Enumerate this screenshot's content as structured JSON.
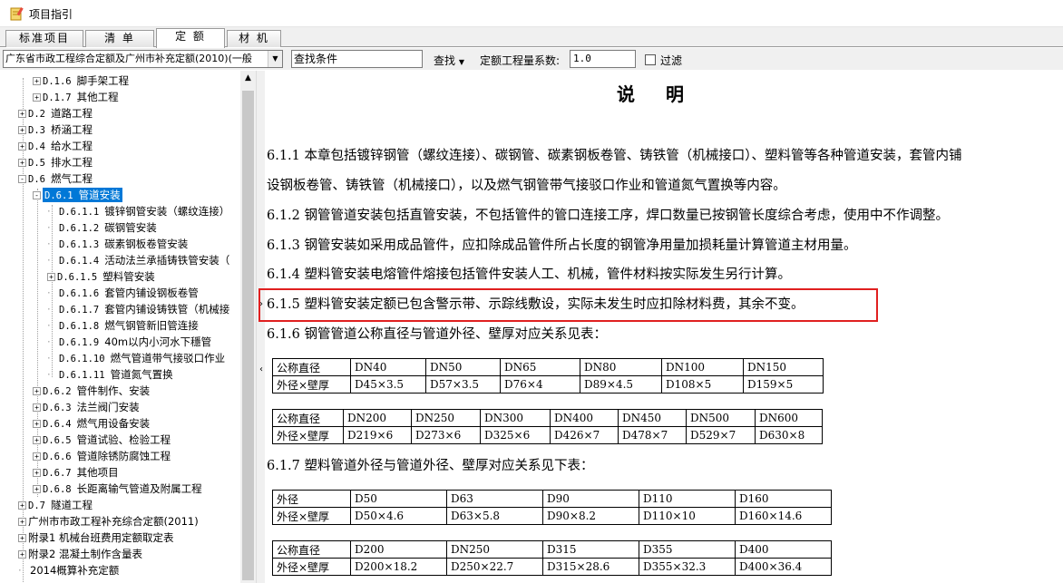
{
  "window": {
    "title": "项目指引"
  },
  "tabs": [
    {
      "label": "标准项目",
      "active": false
    },
    {
      "label": "清 单",
      "active": false
    },
    {
      "label": "定 额",
      "active": true
    },
    {
      "label": "材 机",
      "active": false
    }
  ],
  "toolbar": {
    "quota_select": "广东省市政工程综合定额及广州市补充定额(2010)(一般",
    "search_placeholder": "查找条件",
    "find_label": "查找",
    "coef_label": "定额工程量系数:",
    "coef_value": "1.0",
    "filter_label": "过滤",
    "filter_checked": false
  },
  "tree": [
    {
      "expander": "+",
      "code": "D.1.6",
      "label": "脚手架工程"
    },
    {
      "expander": "+",
      "code": "D.1.7",
      "label": "其他工程"
    },
    {
      "expander": "+",
      "code": "D.2",
      "label": "道路工程"
    },
    {
      "expander": "+",
      "code": "D.3",
      "label": "桥涵工程"
    },
    {
      "expander": "+",
      "code": "D.4",
      "label": "给水工程"
    },
    {
      "expander": "+",
      "code": "D.5",
      "label": "排水工程"
    },
    {
      "expander": "-",
      "code": "D.6",
      "label": "燃气工程"
    },
    {
      "expander": "-",
      "code": "D.6.1",
      "label": "管道安装",
      "selected": true
    },
    {
      "expander": "",
      "code": "D.6.1.1",
      "label": "镀锌钢管安装（螺纹连接）"
    },
    {
      "expander": "",
      "code": "D.6.1.2",
      "label": "碳钢管安装"
    },
    {
      "expander": "",
      "code": "D.6.1.3",
      "label": "碳素钢板卷管安装"
    },
    {
      "expander": "",
      "code": "D.6.1.4",
      "label": "活动法兰承插铸铁管安装（"
    },
    {
      "expander": "+",
      "code": "D.6.1.5",
      "label": "塑料管安装"
    },
    {
      "expander": "",
      "code": "D.6.1.6",
      "label": "套管内铺设钢板卷管"
    },
    {
      "expander": "",
      "code": "D.6.1.7",
      "label": "套管内铺设铸铁管（机械接"
    },
    {
      "expander": "",
      "code": "D.6.1.8",
      "label": "燃气钢管新旧管连接"
    },
    {
      "expander": "",
      "code": "D.6.1.9",
      "label": "40m以内小河水下穩管"
    },
    {
      "expander": "",
      "code": "D.6.1.10",
      "label": "燃气管道带气接驳口作业"
    },
    {
      "expander": "",
      "code": "D.6.1.11",
      "label": "管道氮气置换"
    },
    {
      "expander": "+",
      "code": "D.6.2",
      "label": "管件制作、安装"
    },
    {
      "expander": "+",
      "code": "D.6.3",
      "label": "法兰阀门安装"
    },
    {
      "expander": "+",
      "code": "D.6.4",
      "label": "燃气用设备安装"
    },
    {
      "expander": "+",
      "code": "D.6.5",
      "label": "管道试验、检验工程"
    },
    {
      "expander": "+",
      "code": "D.6.6",
      "label": "管道除锈防腐蚀工程"
    },
    {
      "expander": "+",
      "code": "D.6.7",
      "label": "其他项目"
    },
    {
      "expander": "+",
      "code": "D.6.8",
      "label": "长距离输气管道及附属工程"
    },
    {
      "expander": "+",
      "code": "D.7",
      "label": "隧道工程"
    },
    {
      "expander": "+",
      "code": "",
      "label": "广州市市政工程补充综合定额(2011)"
    },
    {
      "expander": "+",
      "code": "",
      "label": "附录1 机械台班费用定额取定表"
    },
    {
      "expander": "+",
      "code": "",
      "label": "附录2 混凝土制作含量表"
    },
    {
      "expander": "",
      "code": "",
      "label": "2014概算补充定额"
    }
  ],
  "doc": {
    "title": "说明",
    "paragraphs": [
      "6.1.1  本章包括镀锌钢管（螺纹连接）、碳钢管、碳素钢板卷管、铸铁管（机械接口）、塑料管等各种管道安装，套管内铺",
      "设钢板卷管、铸铁管（机械接口），以及燃气钢管带气接驳口作业和管道氮气置换等内容。",
      "6.1.2  钢管管道安装包括直管安装，不包括管件的管口连接工序，焊口数量已按钢管长度综合考虑，使用中不作调整。",
      "6.1.3  钢管安装如采用成品管件，应扣除成品管件所占长度的钢管净用量加损耗量计算管道主材用量。",
      "6.1.4  塑料管安装电熔管件熔接包括管件安装人工、机械，管件材料按实际发生另行计算。",
      "6.1.5  塑料管安装定额已包含警示带、示踪线敷设，实际未发生时应扣除材料费，其余不变。",
      "6.1.6  钢管管道公称直径与管道外径、壁厚对应关系见表：",
      "6.1.7  塑料管道外径与管道外径、壁厚对应关系见下表："
    ],
    "tables": [
      {
        "rows": [
          [
            "公称直径",
            "DN40",
            "DN50",
            "DN65",
            "DN80",
            "DN100",
            "DN150"
          ],
          [
            "外径×壁厚",
            "D45×3.5",
            "D57×3.5",
            "D76×4",
            "D89×4.5",
            "D108×5",
            "D159×5"
          ]
        ]
      },
      {
        "rows": [
          [
            "公称直径",
            "DN200",
            "DN250",
            "DN300",
            "DN400",
            "DN450",
            "DN500",
            "DN600"
          ],
          [
            "外径×壁厚",
            "D219×6",
            "D273×6",
            "D325×6",
            "D426×7",
            "D478×7",
            "D529×7",
            "D630×8"
          ]
        ]
      },
      {
        "rows": [
          [
            "外径",
            "D50",
            "D63",
            "D90",
            "D110",
            "D160"
          ],
          [
            "外径×壁厚",
            "D50×4.6",
            "D63×5.8",
            "D90×8.2",
            "D110×10",
            "D160×14.6"
          ]
        ]
      },
      {
        "rows": [
          [
            "公称直径",
            "D200",
            "DN250",
            "D315",
            "D355",
            "D400"
          ],
          [
            "外径×壁厚",
            "D200×18.2",
            "D250×22.7",
            "D315×28.6",
            "D355×32.3",
            "D400×36.4"
          ]
        ]
      }
    ]
  },
  "colors": {
    "selection": "#0078d7",
    "highlight_box": "#e02020"
  }
}
